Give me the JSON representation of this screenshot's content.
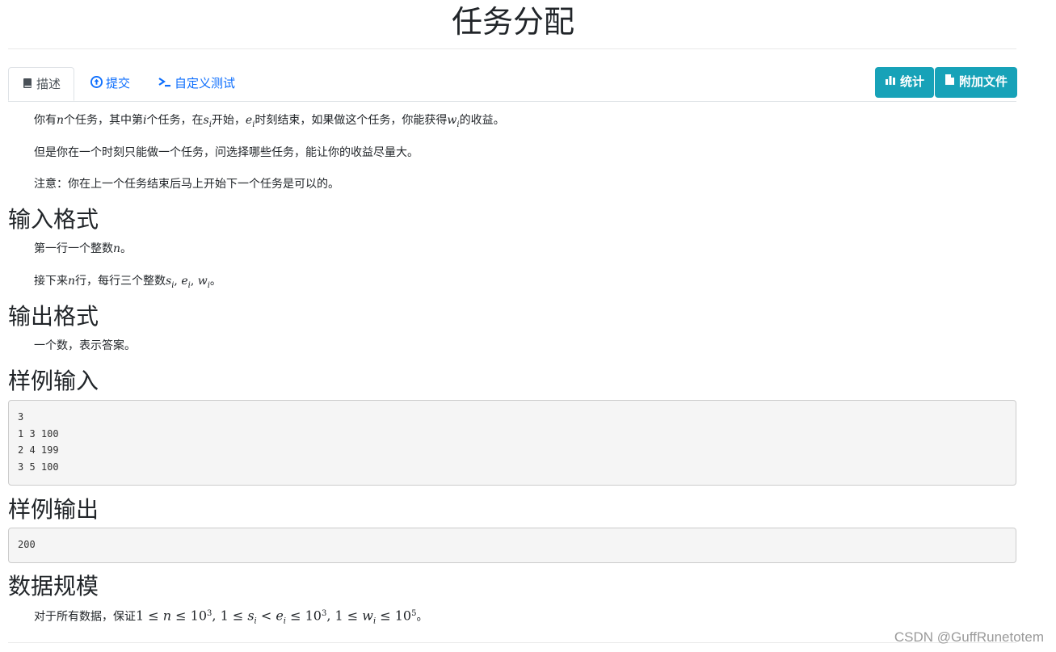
{
  "title": "任务分配",
  "tabs": [
    {
      "label": "描述",
      "icon": "book-icon"
    },
    {
      "label": "提交",
      "icon": "upload-circle-icon"
    },
    {
      "label": "自定义测试",
      "icon": "terminal-icon"
    }
  ],
  "buttons": [
    {
      "label": "统计",
      "icon": "bar-chart-icon"
    },
    {
      "label": "附加文件",
      "icon": "file-icon"
    }
  ],
  "description": {
    "p1": {
      "a": "你有",
      "n": "n",
      "b": "个任务，其中第",
      "i": "i",
      "c": "个任务，在",
      "s": "s",
      "si": "i",
      "d": "开始，",
      "e": "e",
      "ei": "i",
      "f": "时刻结束，如果做这个任务，你能获得",
      "w": "w",
      "wi": "i",
      "g": "的收益。"
    },
    "p2": "但是你在一个时刻只能做一个任务，问选择哪些任务，能让你的收益尽量大。",
    "p3": "注意：你在上一个任务结束后马上开始下一个任务是可以的。"
  },
  "input_format": {
    "heading": "输入格式",
    "p1": {
      "a": "第一行一个整数",
      "n": "n",
      "b": "。"
    },
    "p2": {
      "a": "接下来",
      "n": "n",
      "b": "行，每行三个整数",
      "vars": "s",
      "si": "i",
      "c1": ", ",
      "e": "e",
      "ei": "i",
      "c2": ", ",
      "w": "w",
      "wi": "i",
      "d": "。"
    }
  },
  "output_format": {
    "heading": "输出格式",
    "p1": "一个数，表示答案。"
  },
  "sample_input": {
    "heading": "样例输入",
    "text": "3\n1 3 100\n2 4 199\n3 5 100"
  },
  "sample_output": {
    "heading": "样例输出",
    "text": "200"
  },
  "constraints": {
    "heading": "数据规模",
    "a": "对于所有数据，保证",
    "b": "1 ≤ ",
    "n": "n",
    "c": " ≤ 10",
    "e1": "3",
    "d": ", 1 ≤ ",
    "s": "s",
    "si": "i",
    "f": " < ",
    "ee": "e",
    "ei": "i",
    "g": " ≤ 10",
    "e2": "3",
    "h": ", 1 ≤ ",
    "w": "w",
    "wi": "i",
    "k": " ≤ 10",
    "e3": "5",
    "end": "。"
  },
  "watermark": "CSDN @GuffRunetotem",
  "colors": {
    "link": "#0d6efd",
    "button": "#17a2b8",
    "pre_bg": "#f5f5f5"
  }
}
